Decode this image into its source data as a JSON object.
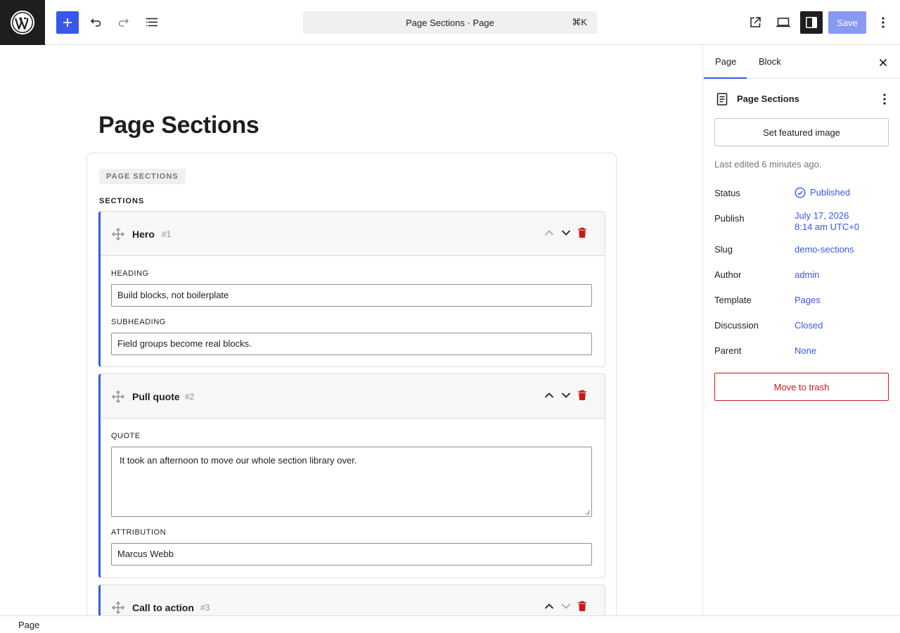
{
  "toolbar": {
    "document_title": "Page Sections · Page",
    "shortcut": "⌘K",
    "save_label": "Save"
  },
  "editor": {
    "page_title": "Page Sections",
    "block_badge": "PAGE SECTIONS",
    "sections_label": "SECTIONS",
    "sections": [
      {
        "name": "Hero",
        "number": "#1",
        "fields": [
          {
            "label": "HEADING",
            "value": "Build blocks, not boilerplate"
          },
          {
            "label": "SUBHEADING",
            "value": "Field groups become real blocks."
          }
        ]
      },
      {
        "name": "Pull quote",
        "number": "#2",
        "fields": [
          {
            "label": "QUOTE",
            "value": "It took an afternoon to move our whole section library over."
          },
          {
            "label": "ATTRIBUTION",
            "value": "Marcus Webb"
          }
        ]
      },
      {
        "name": "Call to action",
        "number": "#3",
        "fields": []
      }
    ]
  },
  "sidebar": {
    "tabs": [
      "Page",
      "Block"
    ],
    "doc_title": "Page Sections",
    "featured_image_label": "Set featured image",
    "last_edited": "Last edited 6 minutes ago.",
    "meta": {
      "status": {
        "label": "Status",
        "value": "Published"
      },
      "publish": {
        "label": "Publish",
        "value_line1": "July 17, 2026",
        "value_line2": "8:14 am UTC+0"
      },
      "slug": {
        "label": "Slug",
        "value": "demo-sections"
      },
      "author": {
        "label": "Author",
        "value": "admin"
      },
      "template": {
        "label": "Template",
        "value": "Pages"
      },
      "discussion": {
        "label": "Discussion",
        "value": "Closed"
      },
      "parent": {
        "label": "Parent",
        "value": "None"
      }
    },
    "trash_label": "Move to trash"
  },
  "footer": {
    "breadcrumb": "Page"
  },
  "colors": {
    "accent": "#3858e9",
    "danger": "#cc1818",
    "dark": "#1e1e1e"
  }
}
